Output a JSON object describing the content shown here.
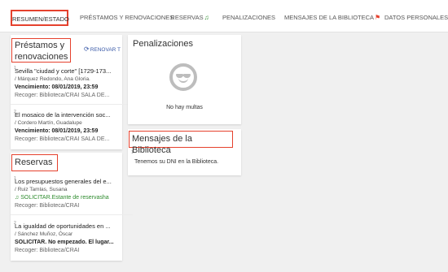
{
  "tabs": [
    {
      "label": "RESUMEN/ESTADO"
    },
    {
      "label": "PRÉSTAMOS Y RENOVACIONES"
    },
    {
      "label": "RESERVAS"
    },
    {
      "label": "PENALIZACIONES"
    },
    {
      "label": "MENSAJES DE LA BIBLIOTECA"
    },
    {
      "label": "DATOS PERSONALES"
    }
  ],
  "loans": {
    "title": "Préstamos y renovaciones",
    "renew_label": "RENOVAR T",
    "items": [
      {
        "index": "1",
        "title": "Sevilla \"ciudad y corte\" [1729-173...",
        "author": "/ Márquez Redondo, Ana Gloria.",
        "due": "Vencimiento: 08/01/2019, 23:59",
        "pickup": "Recoger: Biblioteca/CRAI SALA DE..."
      },
      {
        "index": "2",
        "title": "El mosaico de la intervención soc...",
        "author": "/ Cordero Martín, Guadalupe",
        "due": "Vencimiento: 08/01/2019, 23:59",
        "pickup": "Recoger: Biblioteca/CRAI SALA DE..."
      }
    ]
  },
  "holds": {
    "title": "Reservas",
    "items": [
      {
        "index": "1",
        "title": "Los presupuestos generales del e...",
        "author": "/ Ruiz Tamlas, Susana",
        "status": "SOLICITAR.Estante de reservasha",
        "pickup": "Recoger: Biblioteca/CRAI"
      },
      {
        "index": "2",
        "title": "La igualdad de oportunidades en ...",
        "author": "/ Sánchez Muñoz, Óscar",
        "status": "SOLICITAR. No empezado. El lugar...",
        "pickup": "Recoger: Biblioteca/CRAI"
      }
    ]
  },
  "fines": {
    "title": "Penalizaciones",
    "empty_text": "No hay multas"
  },
  "messages": {
    "title": "Mensajes de la Biblioteca",
    "items": [
      {
        "index": "1",
        "text": "Tenemos su DNI en la Biblioteca."
      }
    ]
  },
  "colors": {
    "highlight": "#e5412d",
    "link": "#3a5aa8",
    "hold_status": "#2e8b2e"
  }
}
